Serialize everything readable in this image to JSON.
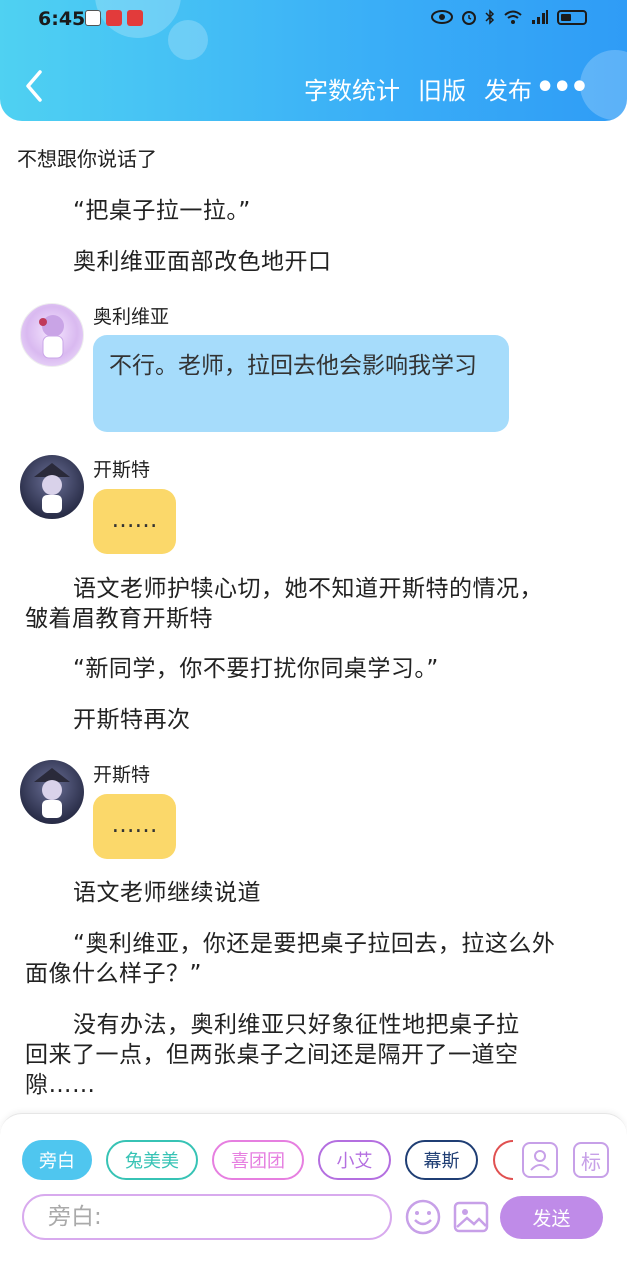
{
  "status_bar": {
    "time": "6:45"
  },
  "header": {
    "actions": [
      "字数统计",
      "旧版",
      "发布"
    ],
    "more_label": "•••"
  },
  "chapter": {
    "title": "不想跟你说话了"
  },
  "story": {
    "p1": "“把桌子拉一拉。”",
    "p2": "奥利维亚面部改色地开口",
    "msg1": {
      "name": "奥利维亚",
      "text": "不行。老师，拉回去他会影响我学习"
    },
    "msg2": {
      "name": "开斯特",
      "text": "……"
    },
    "p3_line1": "语文老师护犊心切，她不知道开斯特的情况，",
    "p3_line2": "皱着眉教育开斯特",
    "p4": "“新同学，你不要打扰你同桌学习。”",
    "p5": "开斯特再次",
    "msg3": {
      "name": "开斯特",
      "text": "……"
    },
    "p6": "语文老师继续说道",
    "p7_line1": "“奥利维亚，你还是要把桌子拉回去，拉这么外",
    "p7_line2": "面像什么样子？”",
    "p8_line1": "没有办法，奥利维亚只好象征性地把桌子拉",
    "p8_line2": "回来了一点，但两张桌子之间还是隔开了一道空",
    "p8_line3": "隙……"
  },
  "composer": {
    "roles": [
      {
        "label": "旁白",
        "color": "#4fc6ef"
      },
      {
        "label": "兔美美",
        "color": "#37c3b5"
      },
      {
        "label": "喜团团",
        "color": "#e67fe0"
      },
      {
        "label": "小艾",
        "color": "#b46fe0"
      },
      {
        "label": "幕斯",
        "color": "#1f3e74"
      }
    ],
    "mark_label": "标",
    "placeholder": "旁白:",
    "send_label": "发送"
  },
  "colors": {
    "header_start": "#4fd1f2",
    "header_end": "#2f9cf6",
    "bubble_blue": "#a6dcfb",
    "bubble_yellow": "#fbd86a",
    "send_button": "#bf8be8"
  }
}
